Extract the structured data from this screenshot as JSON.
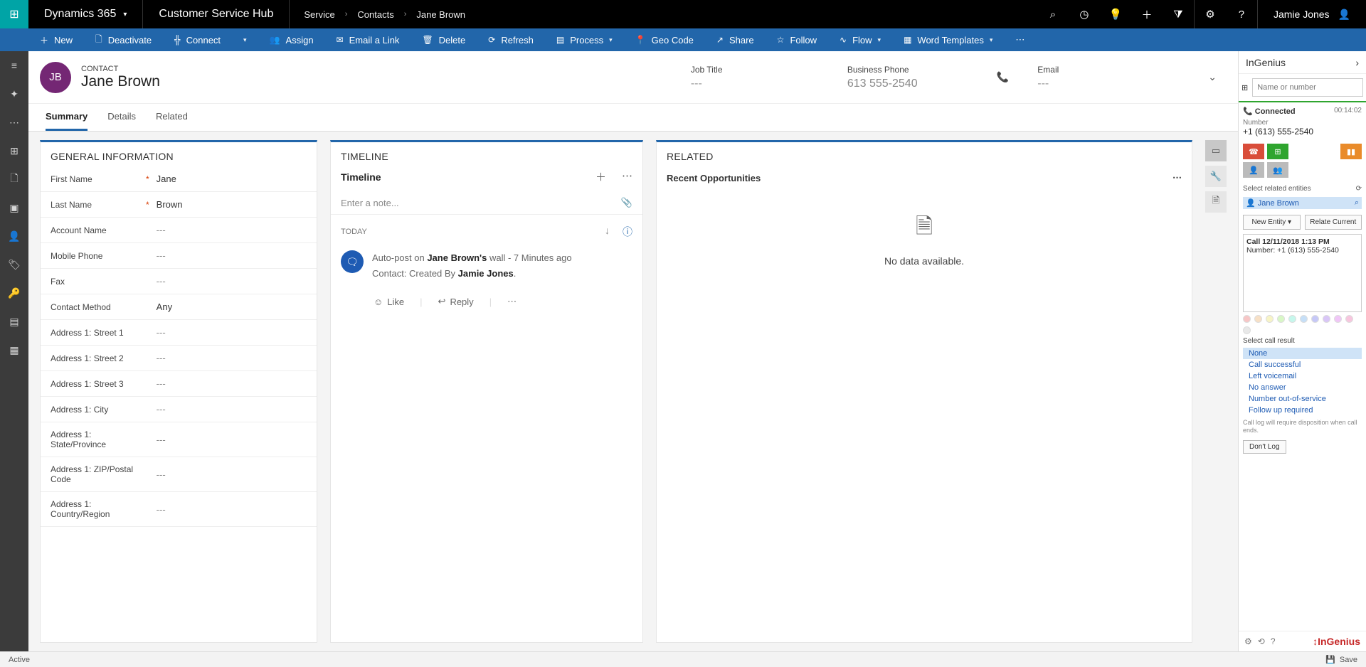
{
  "topbar": {
    "brand": "Dynamics 365",
    "hub": "Customer Service Hub",
    "breadcrumbs": [
      "Service",
      "Contacts",
      "Jane Brown"
    ],
    "user": "Jamie Jones"
  },
  "commandbar": {
    "new": "New",
    "deactivate": "Deactivate",
    "connect": "Connect",
    "assign": "Assign",
    "email_link": "Email a Link",
    "delete": "Delete",
    "refresh": "Refresh",
    "process": "Process",
    "geocode": "Geo Code",
    "share": "Share",
    "follow": "Follow",
    "flow": "Flow",
    "word_templates": "Word Templates"
  },
  "record": {
    "entity_label": "CONTACT",
    "initials": "JB",
    "name": "Jane Brown",
    "header_fields": {
      "job_title": {
        "label": "Job Title",
        "value": "---"
      },
      "business_phone": {
        "label": "Business Phone",
        "value": "613 555-2540"
      },
      "email": {
        "label": "Email",
        "value": "---"
      }
    }
  },
  "tabs": [
    "Summary",
    "Details",
    "Related"
  ],
  "general": {
    "title": "GENERAL INFORMATION",
    "fields": [
      {
        "label": "First Name",
        "required": true,
        "value": "Jane"
      },
      {
        "label": "Last Name",
        "required": true,
        "value": "Brown"
      },
      {
        "label": "Account Name",
        "required": false,
        "value": "---"
      },
      {
        "label": "Mobile Phone",
        "required": false,
        "value": "---"
      },
      {
        "label": "Fax",
        "required": false,
        "value": "---"
      },
      {
        "label": "Contact Method",
        "required": false,
        "value": "Any"
      },
      {
        "label": "Address 1: Street 1",
        "required": false,
        "value": "---"
      },
      {
        "label": "Address 1: Street 2",
        "required": false,
        "value": "---"
      },
      {
        "label": "Address 1: Street 3",
        "required": false,
        "value": "---"
      },
      {
        "label": "Address 1: City",
        "required": false,
        "value": "---"
      },
      {
        "label": "Address 1: State/Province",
        "required": false,
        "value": "---"
      },
      {
        "label": "Address 1: ZIP/Postal Code",
        "required": false,
        "value": "---"
      },
      {
        "label": "Address 1: Country/Region",
        "required": false,
        "value": "---"
      }
    ]
  },
  "timeline": {
    "title": "TIMELINE",
    "subtitle": "Timeline",
    "note_placeholder": "Enter a note...",
    "today_label": "TODAY",
    "post": {
      "prefix": "Auto-post on ",
      "who": "Jane Brown's",
      "suffix": " wall - ",
      "age": "7 Minutes ago",
      "line2_prefix": "Contact: Created By ",
      "line2_who": "Jamie Jones",
      "line2_suffix": "."
    },
    "like": "Like",
    "reply": "Reply"
  },
  "related": {
    "title": "RELATED",
    "section": "Recent Opportunities",
    "nodata": "No data available."
  },
  "ingenius": {
    "title": "InGenius",
    "dial_placeholder": "Name or number",
    "status": "Connected",
    "timer": "00:14:02",
    "number_label": "Number",
    "number": "+1 (613) 555-2540",
    "select_related": "Select related entities",
    "rel_name": "Jane Brown",
    "new_entity": "New Entity",
    "relate_current": "Relate Current",
    "log_title": "Call 12/11/2018 1:13 PM",
    "log_number": "Number: +1 (613) 555-2540",
    "select_result": "Select call result",
    "results": [
      "None",
      "Call successful",
      "Left voicemail",
      "No answer",
      "Number out-of-service",
      "Follow up required"
    ],
    "note": "Call log will require disposition when call ends.",
    "dont_log": "Don't Log",
    "logo": "InGenius"
  },
  "statusbar": {
    "status": "Active",
    "save": "Save"
  }
}
